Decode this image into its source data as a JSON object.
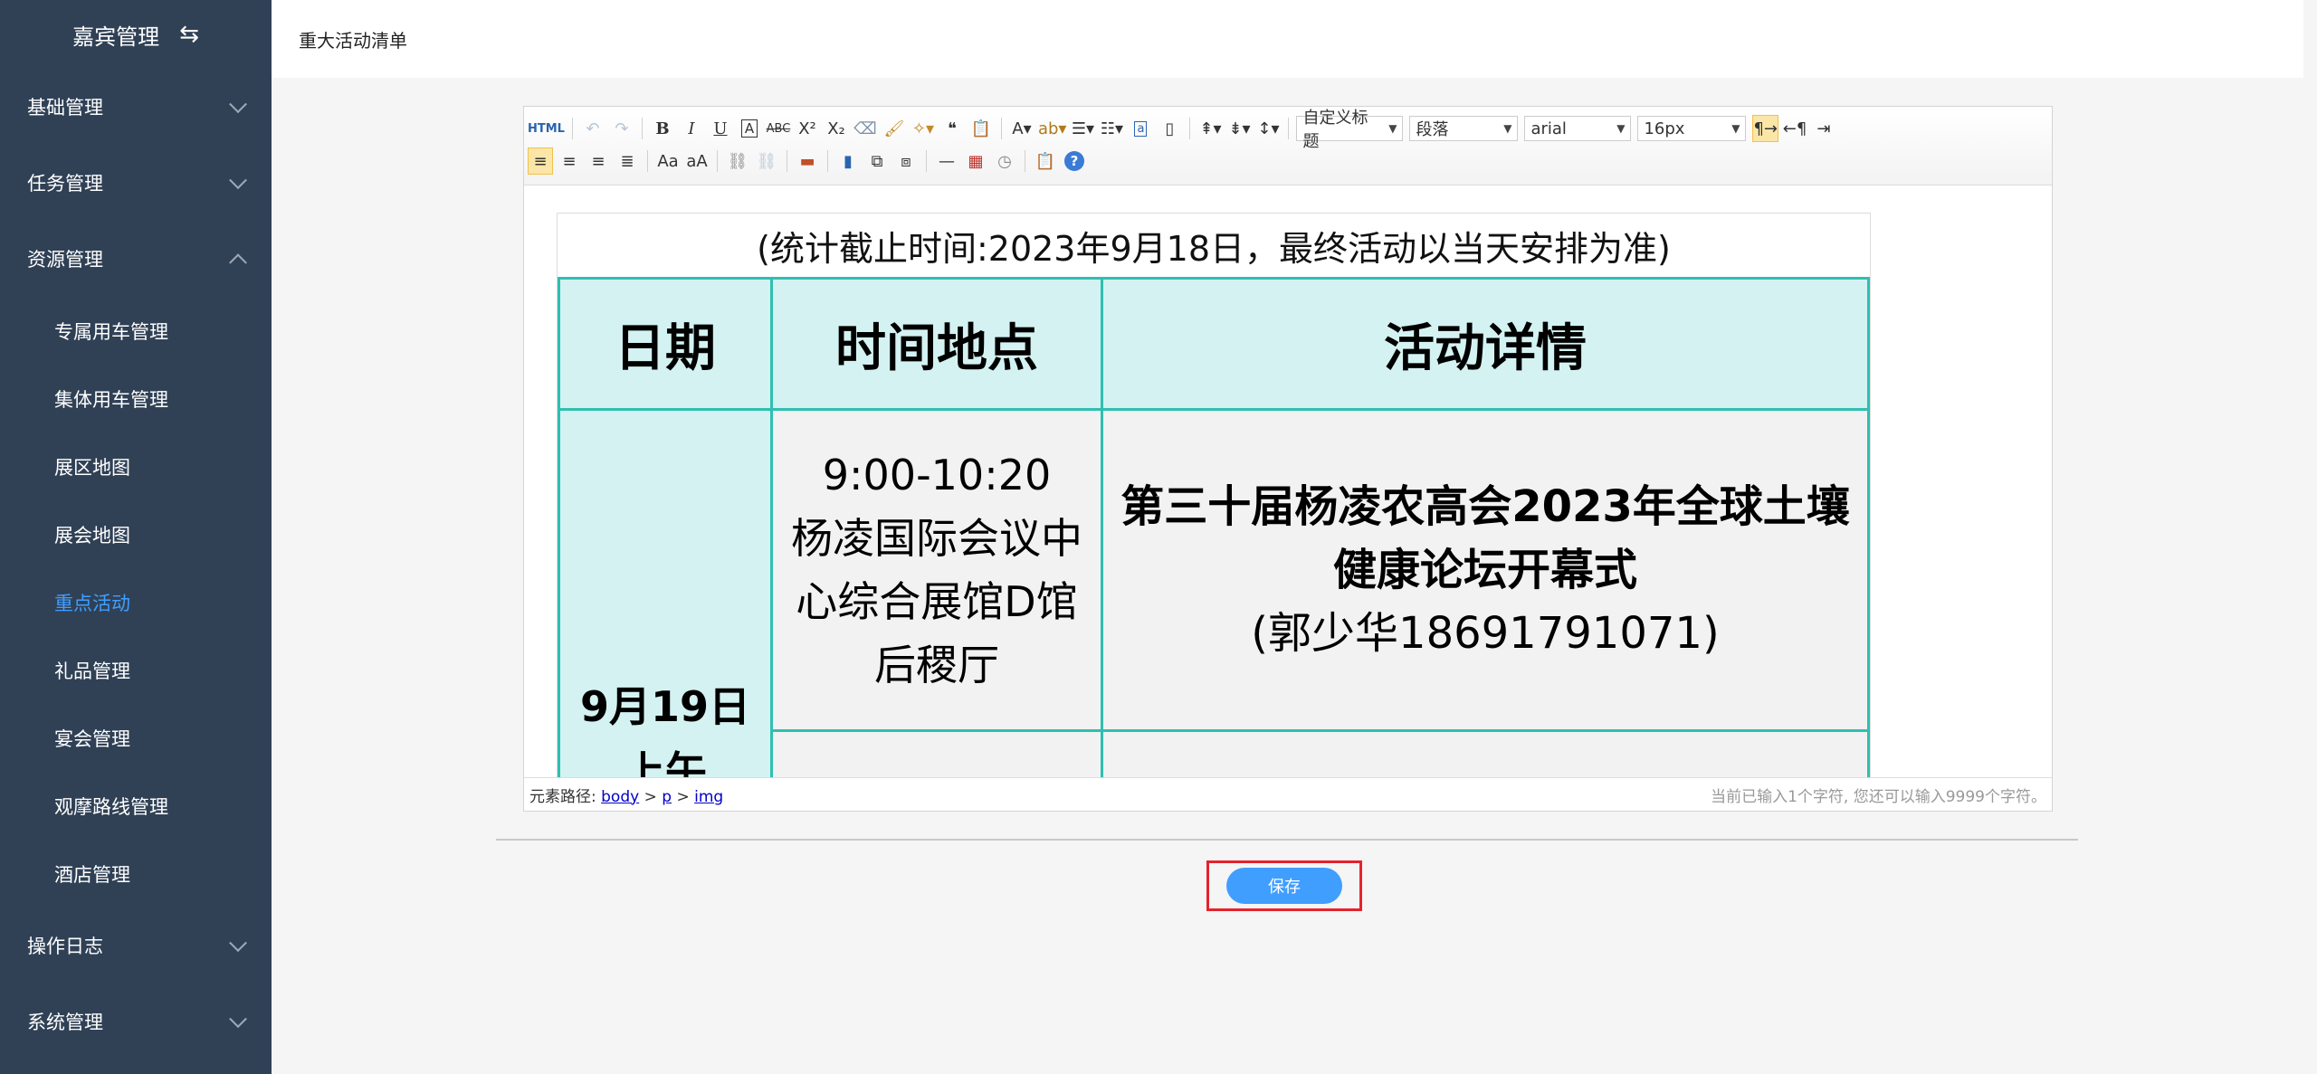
{
  "sidebar": {
    "title": "嘉宾管理",
    "toggle_icon": "swap-icon",
    "menu": [
      {
        "label": "基础管理",
        "state": "collapsed"
      },
      {
        "label": "任务管理",
        "state": "collapsed"
      },
      {
        "label": "资源管理",
        "state": "expanded"
      },
      {
        "label": "操作日志",
        "state": "collapsed"
      },
      {
        "label": "系统管理",
        "state": "collapsed"
      }
    ],
    "sub_items": [
      "专属用车管理",
      "集体用车管理",
      "展区地图",
      "展会地图",
      "重点活动",
      "礼品管理",
      "宴会管理",
      "观摩路线管理",
      "酒店管理"
    ],
    "active_sub": "重点活动",
    "colors": {
      "bg": "#304156",
      "active": "#409eff"
    }
  },
  "header": {
    "title": "重大活动清单"
  },
  "toolbar": {
    "source_label": "HTML",
    "font_letter": "A",
    "bold": "B",
    "italic": "I",
    "underline": "U",
    "strike": "ABC",
    "superscript": "X²",
    "subscript": "X₂",
    "quote": "❝",
    "combos": {
      "heading": "自定义标题",
      "paragraph": "段落",
      "font_family": "arial",
      "font_size": "16px"
    },
    "horizontal_rule": "—",
    "help": "?"
  },
  "document": {
    "note": "(统计截止时间:2023年9月18日，最终活动以当天安排为准)",
    "headers": [
      "日期",
      "时间地点",
      "活动详情"
    ],
    "row1": {
      "date": "9月19日",
      "date_suffix": "上午",
      "time": "9:00-10:20",
      "place_line1": "杨凌国际会议中",
      "place_line2": "心综合展馆D馆",
      "place_line3": "后稷厅",
      "event_line1": "第三十届杨凌农高会2023年全球土壤",
      "event_line2": "健康论坛开幕式",
      "contact": "(郭少华18691791071)"
    }
  },
  "status": {
    "path_label": "元素路径:",
    "path": [
      "body",
      "p",
      "img"
    ],
    "separator": " > ",
    "count_text": "当前已输入1个字符, 您还可以输入9999个字符。"
  },
  "actions": {
    "save_label": "保存",
    "highlight_color": "#e5232d",
    "button_color": "#409eff"
  }
}
